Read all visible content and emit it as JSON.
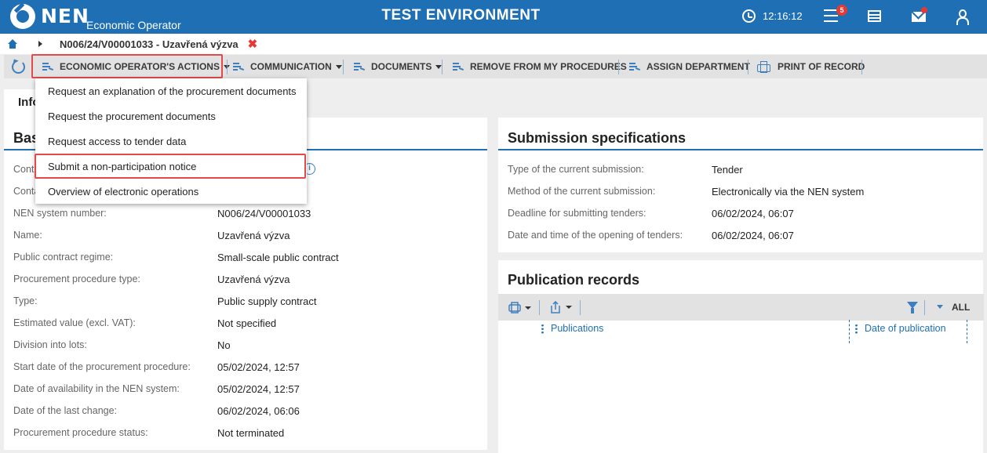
{
  "header": {
    "logo_text": "NEN",
    "logo_subtitle": "Economic Operator",
    "environment_title": "TEST ENVIRONMENT",
    "clock": "12:16:12",
    "notification_count": "5",
    "colors": {
      "header_bg": "#1f6fb5",
      "badge": "#e53935",
      "highlight_border": "#e04a4a"
    }
  },
  "breadcrumb": {
    "title": "N006/24/V00001033 - Uzavřená výzva",
    "close_glyph": "✖"
  },
  "toolbar": {
    "items": [
      {
        "label": "ECONOMIC OPERATOR'S ACTIONS",
        "has_caret": true,
        "icon": "lines-icon"
      },
      {
        "label": "COMMUNICATION",
        "has_caret": true,
        "icon": "lines-icon"
      },
      {
        "label": "DOCUMENTS",
        "has_caret": true,
        "icon": "lines-icon"
      },
      {
        "label": "REMOVE FROM MY PROCEDURES",
        "has_caret": false,
        "icon": "lines-icon"
      },
      {
        "label": "ASSIGN DEPARTMENT",
        "has_caret": false,
        "icon": "lines-icon"
      },
      {
        "label": "PRINT OF RECORD",
        "has_caret": false,
        "icon": "print-icon"
      }
    ]
  },
  "dropdown": {
    "items": [
      "Request an explanation of the procurement documents",
      "Request the procurement documents",
      "Request access to tender data",
      "Submit a non-participation notice",
      "Overview of electronic operations"
    ],
    "highlighted_index": 3
  },
  "tab": {
    "label": "Info"
  },
  "basic_panel": {
    "title": "Bas",
    "rows": [
      {
        "label": "Contr",
        "value": ""
      },
      {
        "label": "Conta",
        "value": ""
      },
      {
        "label": "NEN system number:",
        "value": "N006/24/V00001033"
      },
      {
        "label": "Name:",
        "value": "Uzavřená výzva"
      },
      {
        "label": "Public contract regime:",
        "value": "Small-scale public contract"
      },
      {
        "label": "Procurement procedure type:",
        "value": "Uzavřená výzva"
      },
      {
        "label": "Type:",
        "value": "Public supply contract"
      },
      {
        "label": "Estimated value (excl. VAT):",
        "value": "Not specified"
      },
      {
        "label": "Division into lots:",
        "value": "No"
      },
      {
        "label": "Start date of the procurement procedure:",
        "value": "05/02/2024, 12:57"
      },
      {
        "label": "Date of availability in the NEN system:",
        "value": "05/02/2024, 12:57"
      },
      {
        "label": "Date of the last change:",
        "value": "06/02/2024, 06:06"
      },
      {
        "label": "Procurement procedure status:",
        "value": "Not terminated"
      }
    ]
  },
  "submission_panel": {
    "title": "Submission specifications",
    "rows": [
      {
        "label": "Type of the current submission:",
        "value": "Tender"
      },
      {
        "label": "Method of the current submission:",
        "value": "Electronically via the NEN system"
      },
      {
        "label": "Deadline for submitting tenders:",
        "value": "06/02/2024, 06:07"
      },
      {
        "label": "Date and time of the opening of tenders:",
        "value": "06/02/2024, 06:07"
      }
    ]
  },
  "publication_panel": {
    "title": "Publication records",
    "filter_label": "ALL",
    "columns": [
      "Publications",
      "Date of publication"
    ]
  }
}
